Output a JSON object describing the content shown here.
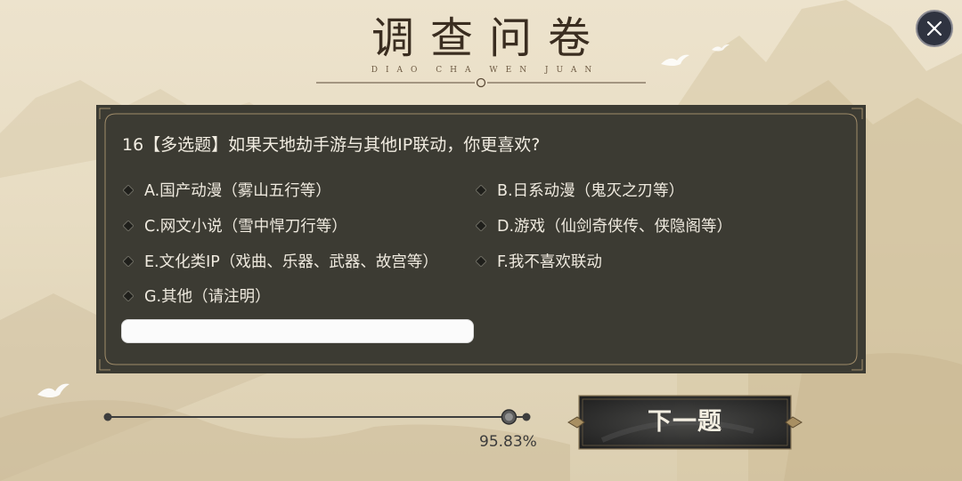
{
  "survey": {
    "title": "调查问卷",
    "subtitle": "DIAO CHA WEN JUAN"
  },
  "question": {
    "text": "16【多选题】如果天地劫手游与其他IP联动，你更喜欢?",
    "options": [
      {
        "label": "A.国产动漫（雾山五行等）",
        "selected": false
      },
      {
        "label": "B.日系动漫（鬼灭之刃等）",
        "selected": false
      },
      {
        "label": "C.网文小说（雪中悍刀行等）",
        "selected": false
      },
      {
        "label": "D.游戏（仙剑奇侠传、侠隐阁等）",
        "selected": false
      },
      {
        "label": "E.文化类IP（戏曲、乐器、武器、故宫等）",
        "selected": false
      },
      {
        "label": "F.我不喜欢联动",
        "selected": false
      },
      {
        "label": "G.其他（请注明）",
        "selected": false
      }
    ],
    "other_input_value": ""
  },
  "progress": {
    "percent": 95.83,
    "label": "95.83%"
  },
  "next_button": {
    "label": "下一题"
  },
  "icons": {
    "close": "close-icon",
    "option_marker": "diamond-icon",
    "decoration": "crane-icon"
  },
  "colors": {
    "panel": "#3c3b33",
    "frame_gold": "#a08c6a",
    "title": "#3a2d20"
  }
}
